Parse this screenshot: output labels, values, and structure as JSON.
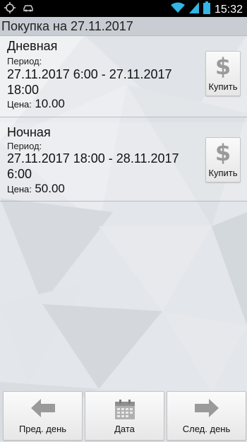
{
  "status_bar": {
    "time": "15:32",
    "icons": [
      "gps-icon",
      "car-icon",
      "wifi-icon",
      "signal-icon",
      "battery-icon"
    ]
  },
  "header": {
    "title": "Покупка на 27.11.2017"
  },
  "tariffs": [
    {
      "name": "Дневная",
      "period_label": "Период:",
      "period_line1": "27.11.2017 6:00 - 27.11.2017",
      "period_line2": "18:00",
      "price_label": "Цена:",
      "price": "10.00",
      "buy_label": "Купить"
    },
    {
      "name": "Ночная",
      "period_label": "Период:",
      "period_line1": "27.11.2017 18:00 - 28.11.2017",
      "period_line2": "6:00",
      "price_label": "Цена:",
      "price": "50.00",
      "buy_label": "Купить"
    }
  ],
  "bottom_nav": {
    "prev_label": "Пред. день",
    "date_label": "Дата",
    "next_label": "След. день"
  },
  "colors": {
    "status_bar": "#000000",
    "title_bar": "#c7cdd3",
    "background": "#dfe3e8",
    "icon_gray": "#9a9a9a",
    "wifi_blue": "#33b5e5"
  }
}
